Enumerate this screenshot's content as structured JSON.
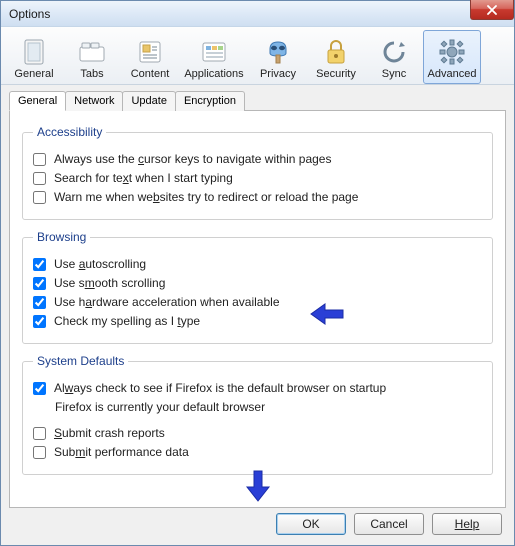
{
  "window": {
    "title": "Options"
  },
  "toolbar": {
    "general": "General",
    "tabs": "Tabs",
    "content": "Content",
    "applications": "Applications",
    "privacy": "Privacy",
    "security": "Security",
    "sync": "Sync",
    "advanced": "Advanced"
  },
  "subtabs": {
    "general": "General",
    "network": "Network",
    "update": "Update",
    "encryption": "Encryption"
  },
  "accessibility": {
    "legend": "Accessibility",
    "cursor": "Always use the cursor keys to navigate within pages",
    "search": "Search for text when I start typing",
    "warn": "Warn me when websites try to redirect or reload the page"
  },
  "browsing": {
    "legend": "Browsing",
    "autoscrolling": "Use autoscrolling",
    "smooth": "Use smooth scrolling",
    "hw": "Use hardware acceleration when available",
    "spell": "Check my spelling as I type"
  },
  "defaults": {
    "legend": "System Defaults",
    "check": "Always check to see if Firefox is the default browser on startup",
    "status": "Firefox is currently your default browser",
    "crash": "Submit crash reports",
    "perf": "Submit performance data"
  },
  "buttons": {
    "ok": "OK",
    "cancel": "Cancel",
    "help": "Help"
  },
  "checked": {
    "cursor": false,
    "search": false,
    "warn": false,
    "auto": true,
    "smooth": true,
    "hw": true,
    "spell": true,
    "defcheck": true,
    "crash": false,
    "perf": false
  }
}
